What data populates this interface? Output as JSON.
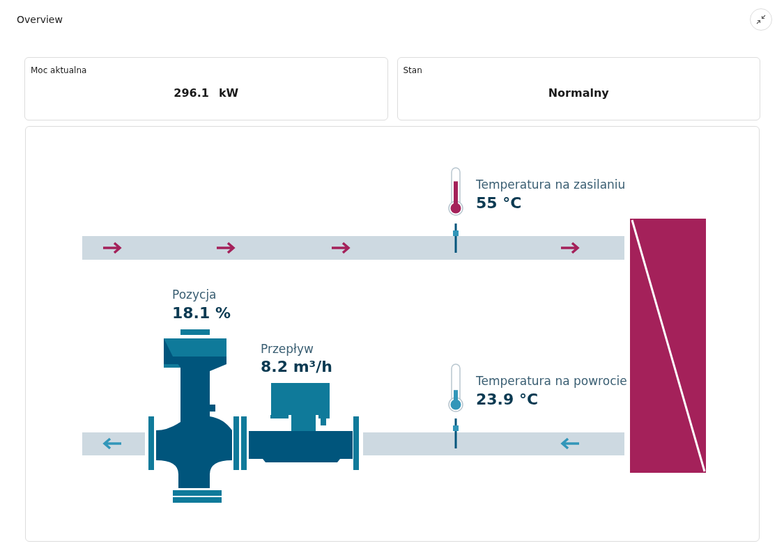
{
  "header": {
    "title": "Overview"
  },
  "cards": [
    {
      "label": "Moc aktualna",
      "value": "296.1",
      "unit": "kW"
    },
    {
      "label": "Stan",
      "value": "Normalny"
    }
  ],
  "diagram": {
    "supply_temperature": {
      "label": "Temperatura na zasilaniu",
      "value": "55 °C",
      "level": 0.72
    },
    "return_temperature": {
      "label": "Temperatura na powrocie",
      "value": "23.9 °C",
      "level": 0.35
    },
    "position": {
      "label": "Pozycja",
      "value": "18.1 %"
    },
    "flow": {
      "label": "Przepływ",
      "value": "8.2 m³/h"
    }
  }
}
